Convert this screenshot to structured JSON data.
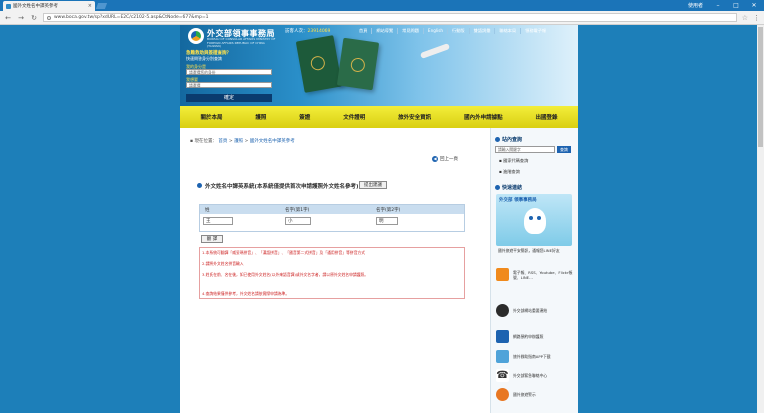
{
  "browser": {
    "tab_title": "國外文姓名中譯英參考",
    "url": "www.boca.gov.tw/sp?xdURL=E2C/c2102-5.asp&CtNode=677&mp=1",
    "user_label": "使用者",
    "minimize": "–",
    "maximize": "□",
    "close": "✕"
  },
  "header": {
    "agency_name": "外交部領事事務局",
    "agency_en": "BUREAU OF CONSULAR AFFAIRS MINISTRY OF FOREIGN AFFAIRS REPUBLIC OF CHINA (TAIWAN)",
    "quick_title": "急難救助與簽證查詢？",
    "quick_sub": "快速問答身分別查詢",
    "quick_label1": "我的身分是",
    "quick_select1": "請選擇您的身份",
    "quick_label2": "我想要",
    "quick_select2": "請選擇",
    "quick_button": "確定",
    "visitor_label": "訪客人次：",
    "visitor_count": "23914069",
    "toplinks": [
      "首頁",
      "網站導覽",
      "常見問題",
      "English",
      "行動版",
      "雙語詞彙",
      "聯絡本局",
      "領務電子報"
    ]
  },
  "nav": [
    "關於本局",
    "護照",
    "簽證",
    "文件證明",
    "旅外安全資訊",
    "國內外申請據點",
    "出國登錄"
  ],
  "breadcrumb": {
    "prefix": "▪ 現在位置：",
    "path": [
      "首頁",
      "護照",
      "國外文姓名中譯英參考"
    ]
  },
  "back_label": "回上一頁",
  "form": {
    "title": "外文姓名中譯英系統(本系統僅提供首次申請護照外文姓名參考)",
    "suggest_button": "提出建議",
    "col_surname": "姓",
    "col_given1": "名字(第1字)",
    "col_given2": "名字(第2字)",
    "val_surname": "王",
    "val_given1": "小",
    "val_given2": "明",
    "translate_button": "翻 譯",
    "notes": [
      "1.本系統可翻譯「威妥瑪拼音」、「漢語拼音」、「國音第二式拼音」及「通用拼音」等拼音方式",
      "2.請將外文姓名拼音輸入",
      "3.姓氏在前、名在後，如已使用外文姓名(以外來語音譯)或外文名字者，請以原外文姓名申請護照。",
      "4.查詢結果僅供參考，外文姓名請依實際申請為準。"
    ]
  },
  "sidebar": {
    "search_title": "站內查詢",
    "search_placeholder": "請輸入關鍵字",
    "search_button": "查詢",
    "links": [
      "▪ 國家代碼查詢",
      "▪ 進階查詢"
    ],
    "quick_title": "快速連結",
    "mascot_text": "外交部 領事事務局",
    "mascot_caption": "國外旅遊平安簡訊，通報您LINE好友",
    "items": [
      {
        "label": "電子報、RSS、Youtube、Flickr帳號、LINE…",
        "color": "#f08a1c"
      },
      {
        "label": "外交部網站重要連結",
        "color": "#2b2b2b"
      },
      {
        "label": "網路預約申辦護照",
        "color": "#1d63b0"
      },
      {
        "label": "旅外救助指南APP下載",
        "color": "#4fa3d9"
      },
      {
        "label": "外交部緊急聯絡中心",
        "color": "#333333"
      },
      {
        "label": "國外旅遊警示",
        "color": "#e87722"
      }
    ]
  }
}
